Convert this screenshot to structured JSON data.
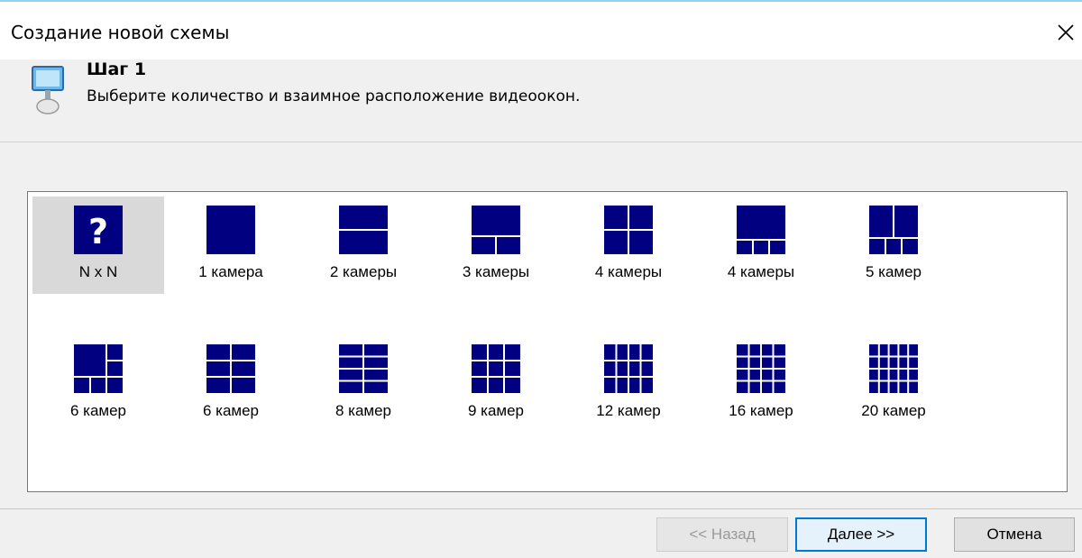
{
  "window": {
    "title": "Создание новой схемы",
    "close_icon": "close-icon"
  },
  "step": {
    "title": "Шаг 1",
    "description": "Выберите количество и взаимное расположение видеоокон.",
    "icon": "monitor-icon"
  },
  "layouts": [
    {
      "label": "N x N",
      "icon": "question-icon",
      "selected": true
    },
    {
      "label": "1 камера",
      "icon": "layout-1-icon"
    },
    {
      "label": "2 камеры",
      "icon": "layout-2-icon"
    },
    {
      "label": "3 камеры",
      "icon": "layout-3-icon"
    },
    {
      "label": "4 камеры",
      "icon": "layout-4-grid-icon"
    },
    {
      "label": "4 камеры",
      "icon": "layout-4-big-top-icon"
    },
    {
      "label": "5 камер",
      "icon": "layout-5-icon"
    },
    {
      "label": "6 камер",
      "icon": "layout-6-a-icon"
    },
    {
      "label": "6 камер",
      "icon": "layout-6-b-icon"
    },
    {
      "label": "8 камер",
      "icon": "layout-8-icon"
    },
    {
      "label": "9 камер",
      "icon": "layout-9-icon"
    },
    {
      "label": "12 камер",
      "icon": "layout-12-icon"
    },
    {
      "label": "16 камер",
      "icon": "layout-16-icon"
    },
    {
      "label": "20 камер",
      "icon": "layout-20-icon"
    }
  ],
  "buttons": {
    "back": "<< Назад",
    "next": "Далее >>",
    "cancel": "Отмена"
  },
  "colors": {
    "tile_fill": "#000080",
    "selected_bg": "#d9d9d9",
    "accent": "#0078d7"
  }
}
